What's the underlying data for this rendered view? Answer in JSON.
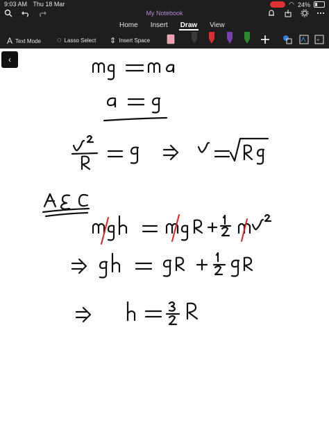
{
  "status": {
    "time": "9:03 AM",
    "date": "Thu 18 Mar",
    "battery": "24%"
  },
  "app": {
    "title": "My Notebook"
  },
  "tabs": [
    {
      "label": "Home"
    },
    {
      "label": "Insert"
    },
    {
      "label": "Draw",
      "active": true
    },
    {
      "label": "View"
    }
  ],
  "toolbar": {
    "text_mode": "Text Mode",
    "lasso_select": "Lasso Select",
    "insert_space": "Insert Space"
  },
  "pens": [
    "#f0a0b0",
    "#222222",
    "#d83030",
    "#7a40b0",
    "#2a8a30",
    "#ffffff"
  ],
  "colors": {
    "accent": "#b58ad8",
    "record": "#e03030",
    "strike": "#e02020"
  }
}
